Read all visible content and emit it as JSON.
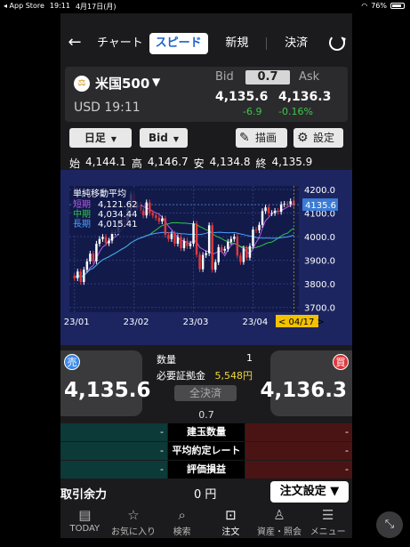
{
  "status": {
    "back_app": "◂ App Store",
    "time": "19:11",
    "date": "4月17日(月)",
    "battery": "76%"
  },
  "nav": {
    "tabs": [
      "チャート",
      "スピード",
      "新規",
      "決済"
    ],
    "active_tab": "スピード"
  },
  "quote": {
    "symbol": "米国500",
    "currency_time": "USD 19:11",
    "bid_label": "Bid",
    "ask_label": "Ask",
    "spread": "0.7",
    "bid": "4,135.6",
    "ask": "4,136.3",
    "change": "-6.9",
    "change_pct": "-0.16%"
  },
  "toolbar": {
    "period": "日足",
    "price_type": "Bid",
    "draw": "描画",
    "settings": "設定"
  },
  "ohlc": {
    "open_label": "始",
    "open": "4,144.1",
    "high_label": "高",
    "high": "4,146.7",
    "low_label": "安",
    "low": "4,134.8",
    "close_label": "終",
    "close": "4,135.9"
  },
  "chart_data": {
    "type": "candlestick",
    "indicator_title": "単純移動平均",
    "legend": [
      {
        "name": "短期",
        "value": "4,121.62",
        "color": "#b65be8"
      },
      {
        "name": "中期",
        "value": "4,034.44",
        "color": "#2ec64a"
      },
      {
        "name": "長期",
        "value": "4,015.41",
        "color": "#4aa3ff"
      }
    ],
    "y_ticks": [
      "4200.0",
      "4100.0",
      "4000.0",
      "3900.0",
      "3800.0",
      "3700.0"
    ],
    "ylim": [
      3680,
      4215
    ],
    "x_ticks": [
      "23/01",
      "23/02",
      "23/03",
      "23/04"
    ],
    "current_price": "4135.6",
    "current_date": "< 04/17 >",
    "candle_up_color": "#ffffff",
    "candle_down_color": "#e03a3a",
    "closes": [
      3824,
      3852,
      3808,
      3860,
      3895,
      3928,
      3896,
      3970,
      3990,
      3999,
      3972,
      3983,
      4018,
      4019,
      4060,
      4070,
      4062,
      4118,
      4180,
      4123,
      4136,
      4110,
      4090,
      4145,
      4100,
      4090,
      4080,
      4065,
      4077,
      4008,
      3990,
      4012,
      3970,
      3998,
      3951,
      3982,
      3960,
      3970,
      4055,
      3924,
      3862,
      3922,
      3930,
      4048,
      3860,
      3892,
      3955,
      3941,
      3948,
      3978,
      3990,
      4000,
      3920,
      3893,
      3950,
      3911,
      3960,
      4030,
      4027,
      4050,
      4108,
      4124,
      4099,
      4100,
      4109,
      4105,
      4137,
      4139,
      4137,
      4150,
      4135
    ]
  },
  "trade": {
    "sell_label": "売",
    "buy_label": "買",
    "sell_price": "4,135.6",
    "buy_price": "4,136.3",
    "qty_label": "数量",
    "qty": "1",
    "margin_label": "必要証拠金",
    "margin": "5,548円",
    "settle_all": "全決済",
    "spread": "0.7"
  },
  "positions": [
    {
      "label": "建玉数量",
      "left": "-",
      "right": "-"
    },
    {
      "label": "平均約定レート",
      "left": "-",
      "right": "-"
    },
    {
      "label": "評価損益",
      "left": "-",
      "right": "-"
    }
  ],
  "account": {
    "available_label": "取引余力",
    "available": "0 円",
    "order_settings": "注文設定 ▼"
  },
  "tabbar": [
    {
      "label": "TODAY",
      "icon": "document-icon"
    },
    {
      "label": "お気に入り",
      "icon": "star-icon"
    },
    {
      "label": "検索",
      "icon": "search-icon"
    },
    {
      "label": "注文",
      "icon": "order-icon",
      "active": true
    },
    {
      "label": "資産・照会",
      "icon": "person-icon"
    },
    {
      "label": "メニュー",
      "icon": "menu-icon"
    }
  ]
}
